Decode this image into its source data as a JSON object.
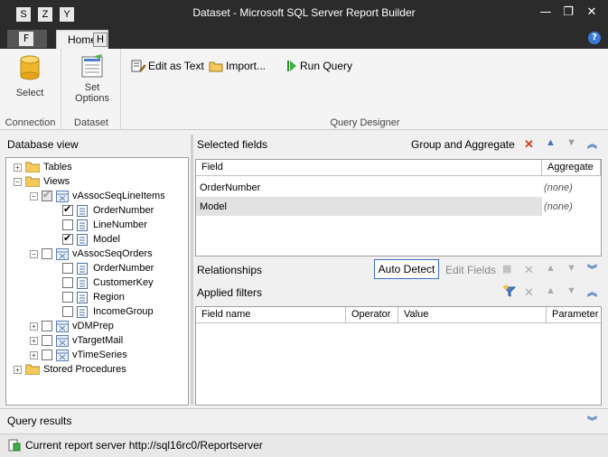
{
  "window": {
    "title": "Dataset - Microsoft SQL Server Report Builder",
    "qat_keys": [
      "S",
      "Z",
      "Y"
    ],
    "minimize": "—",
    "restore": "❐",
    "close": "✕"
  },
  "tabs": {
    "file_key": "F",
    "home_label": "Home",
    "home_key": "H",
    "help": "?"
  },
  "ribbon": {
    "connection": {
      "label": "Connection",
      "select_label": "Select"
    },
    "dataset": {
      "label": "Dataset",
      "set_options_line1": "Set",
      "set_options_line2": "Options"
    },
    "query_designer": {
      "label": "Query Designer",
      "edit_as_text": "Edit as Text",
      "import": "Import...",
      "run_query": "Run Query"
    }
  },
  "database_view": {
    "title": "Database view",
    "tree": [
      {
        "label": "Tables",
        "expander": "+"
      },
      {
        "label": "Views",
        "expander": "−"
      },
      {
        "label": "vAssocSeqLineItems",
        "expander": "−"
      },
      {
        "label": "OrderNumber"
      },
      {
        "label": "LineNumber"
      },
      {
        "label": "Model"
      },
      {
        "label": "vAssocSeqOrders",
        "expander": "−"
      },
      {
        "label": "OrderNumber"
      },
      {
        "label": "CustomerKey"
      },
      {
        "label": "Region"
      },
      {
        "label": "IncomeGroup"
      },
      {
        "label": "vDMPrep",
        "expander": "+"
      },
      {
        "label": "vTargetMail",
        "expander": "+"
      },
      {
        "label": "vTimeSeries",
        "expander": "+"
      },
      {
        "label": "Stored Procedures",
        "expander": "+"
      }
    ]
  },
  "selected_fields": {
    "title": "Selected fields",
    "group_and_aggregate": "Group and Aggregate",
    "columns": [
      "Field",
      "Aggregate"
    ],
    "rows": [
      {
        "field": "OrderNumber",
        "aggregate": "(none)"
      },
      {
        "field": "Model",
        "aggregate": "(none)"
      }
    ]
  },
  "relationships": {
    "title": "Relationships",
    "auto_detect": "Auto Detect",
    "edit_fields": "Edit Fields"
  },
  "applied_filters": {
    "title": "Applied filters",
    "columns": [
      "Field name",
      "Operator",
      "Value",
      "Parameter"
    ]
  },
  "query_results": {
    "title": "Query results"
  },
  "status": {
    "text": "Current report server http://sql16rc0/Reportserver"
  },
  "colors": {
    "titlebar": "#2b2b2b",
    "accent": "#3a6fc4",
    "delete": "#d83b2a",
    "selected_row": "#e2e2e2"
  }
}
